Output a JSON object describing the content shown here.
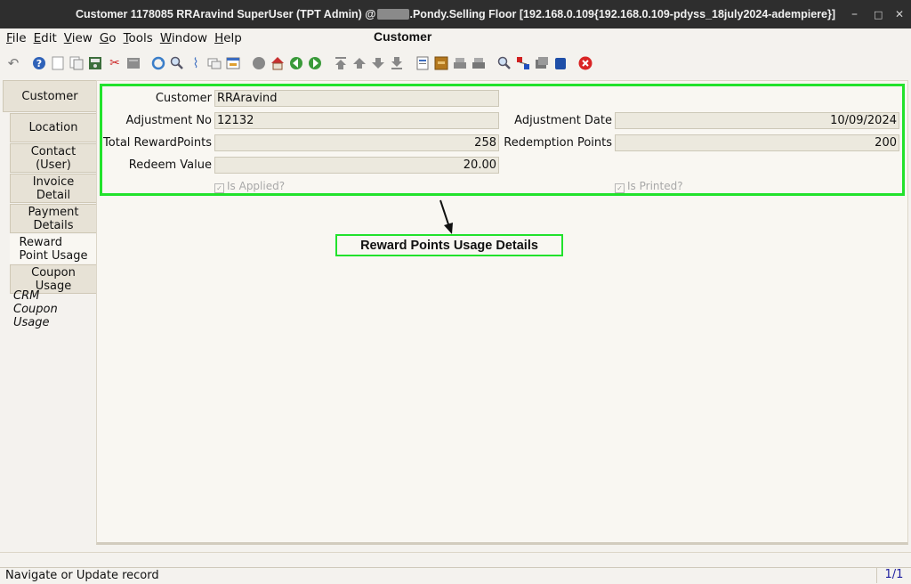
{
  "titlebar": {
    "title_left": "Customer  1178085  RRAravind  SuperUser (TPT Admin) @",
    "title_right": ".Pondy.Selling Floor [192.168.0.109{192.168.0.109-pdyss_18july2024-adempiere}]",
    "minimize": "–",
    "maximize": "□",
    "close": "✕"
  },
  "menu": {
    "file_u": "F",
    "file": "ile",
    "edit_u": "E",
    "edit": "dit",
    "view_u": "V",
    "view": "iew",
    "go_u": "G",
    "go": "o",
    "tools_u": "T",
    "tools": "ools",
    "window_u": "W",
    "window": "indow",
    "help_u": "H",
    "help": "elp"
  },
  "window_title": "Customer",
  "tabs": [
    {
      "label1": "Customer",
      "label2": ""
    },
    {
      "label1": "Location",
      "label2": ""
    },
    {
      "label1": "Contact",
      "label2": "(User)"
    },
    {
      "label1": "Invoice",
      "label2": "Detail"
    },
    {
      "label1": "Payment",
      "label2": "Details"
    },
    {
      "label1": "Reward",
      "label2": "Point Usage"
    },
    {
      "label1": "Coupon",
      "label2": "Usage"
    },
    {
      "label1": "CRM",
      "label2": "Coupon Usage"
    }
  ],
  "form": {
    "customer_label": "Customer",
    "customer_value": "RRAravind",
    "adjustment_no_label": "Adjustment No",
    "adjustment_no_value": "12132",
    "adjustment_date_label": "Adjustment Date",
    "adjustment_date_value": "10/09/2024",
    "total_reward_label": "Total RewardPoints",
    "total_reward_value": "258",
    "redemption_label": "Redemption Points",
    "redemption_value": "200",
    "redeem_value_label": "Redeem Value",
    "redeem_value_value": "20.00",
    "is_applied_label": "Is Applied?",
    "is_printed_label": "Is Printed?",
    "check_mark": "✓"
  },
  "annotation": {
    "label": "Reward Points Usage Details"
  },
  "status": {
    "message": "Navigate or Update record",
    "page": "1/1"
  },
  "toolbar_icons": [
    "undo-icon",
    "help-icon",
    "new-record-icon",
    "copy-record-icon",
    "save-icon",
    "delete-icon",
    "delete-selection-icon",
    "refresh-icon",
    "find-icon",
    "attachment-icon",
    "chat-icon",
    "grid-toggle-icon",
    "history-icon",
    "home-icon",
    "back-icon",
    "forward-icon",
    "first-record-icon",
    "previous-record-icon",
    "next-record-icon",
    "last-record-icon",
    "report-icon",
    "archive-icon",
    "print-preview-icon",
    "print-icon",
    "zoom-across-icon",
    "workflow-icon",
    "product-info-icon",
    "request-icon",
    "exit-icon"
  ],
  "colors": {
    "highlight": "#22e22c",
    "exit": "#d92424"
  }
}
